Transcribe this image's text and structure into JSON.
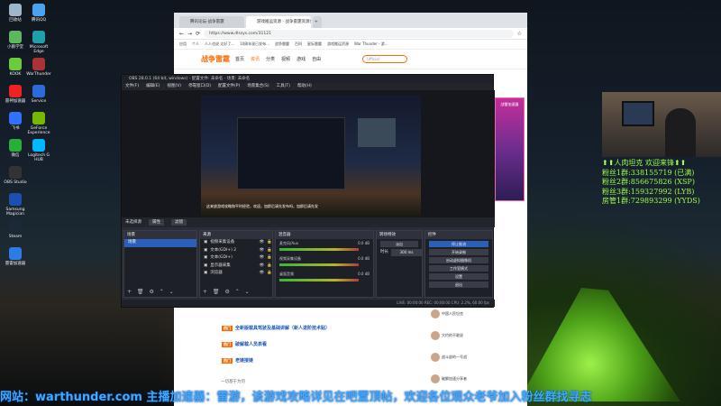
{
  "desktop": {
    "icons": [
      {
        "label": "回收站",
        "color": "#9fb5c9"
      },
      {
        "label": "腾讯QQ",
        "color": "#4aa3ef"
      },
      {
        "label": "小鹅学堂",
        "color": "#5cb85c"
      },
      {
        "label": "Microsoft Edge",
        "color": "#1fa0a8"
      },
      {
        "label": "KOOK",
        "color": "#6bcb3b"
      },
      {
        "label": "WarThunder",
        "color": "#a33"
      },
      {
        "label": "雷神加速器",
        "color": "#e22"
      },
      {
        "label": "Service",
        "color": "#2d6bd8"
      },
      {
        "label": "飞书",
        "color": "#3370ff"
      },
      {
        "label": "GeForce Experience",
        "color": "#76b900"
      },
      {
        "label": "微信",
        "color": "#2bad3b"
      },
      {
        "label": "Logitech G HUB",
        "color": "#00b8fc"
      },
      {
        "label": "OBS Studio",
        "color": "#333"
      },
      {
        "label": "Samsung Magician",
        "color": "#1d4fb1"
      },
      {
        "label": "Steam",
        "color": "#1b2838"
      },
      {
        "label": "雷雷加速器",
        "color": "#2d7be6"
      }
    ]
  },
  "browser": {
    "tabs": [
      "腾讯论坛-战争雷霆",
      "游戏搬运资源 - 战争雷霆资源分享",
      "+"
    ],
    "url": "https://www.dlssys.com/31121",
    "bookmarks": [
      "应用",
      "个人",
      "人人也说 太好了...",
      "10周年现已发布...",
      "战争雷霆",
      "百科",
      "星际雷霆",
      "游戏搬运资源",
      "War Thunder - 游..."
    ],
    "site": {
      "logo": "战争雷霆",
      "nav": [
        "首页",
        "资讯",
        "分类",
        "视频",
        "游戏",
        "自由"
      ],
      "active_nav": "资讯",
      "search_placeholder": "Ufficial"
    },
    "articles": [
      {
        "tag": "热门",
        "title": "全新版载具驾驶及基础讲解（新人进阶技术贴）"
      },
      {
        "tag": "热门",
        "title": "破解载人员表看"
      },
      {
        "tag": "热门",
        "title": "老链接链"
      }
    ],
    "comment_author": "一切基于为何",
    "comments": [
      "中国人民坦克",
      "大约的不敢说",
      "战斗部的一号战",
      "破解加速分享者"
    ]
  },
  "obs": {
    "title": "OBS 28.0.1 (64 bit, windows) - 配置文件: 未命名 - 场景: 未命名",
    "menu": [
      "文件(F)",
      "编辑(E)",
      "视图(V)",
      "停靠窗口(D)",
      "配置文件(P)",
      "场景集合(S)",
      "工具(T)",
      "帮助(H)"
    ],
    "preview_caption": "这来放游戏攻略和平时经验，欢迎，加群后请先发布吗，加群后请先发",
    "context_bar": {
      "label": "未选择源",
      "btn1": "属性",
      "btn2": "滤镜"
    },
    "scenes": {
      "title": "场景",
      "items": [
        "场景"
      ]
    },
    "sources": {
      "title": "来源",
      "items": [
        "视频采集设备",
        "文本(GDI+) 2",
        "文本(GDI+)",
        "显示器采集",
        "浏览器"
      ]
    },
    "mixer": {
      "title": "混音器",
      "channels": [
        {
          "name": "麦克风/Aux",
          "db": "0.0 dB"
        },
        {
          "name": "视频采集设备",
          "db": "0.0 dB"
        },
        {
          "name": "桌面音频",
          "db": "0.0 dB"
        }
      ]
    },
    "transitions": {
      "title": "转场特效",
      "mode": "淡出",
      "duration_label": "时长",
      "duration": "300 ms"
    },
    "controls": {
      "title": "控件",
      "buttons": [
        "停止推流",
        "开始录制",
        "启动虚拟摄像机",
        "工作室模式",
        "设置",
        "退出"
      ]
    },
    "status": "LIVE: 00:00:00   REC: 00:00:00   CPU: 2.2%, 60.00 fps"
  },
  "ad_text": "战雷加速器",
  "fans_overlay": [
    "⬆⬆人肉坦克 欢迎来锋⬆⬆",
    "粉丝1群:338155719 (已满)",
    "粉丝2群:856675826 (XSP)",
    "粉丝3群:159327992 (LYB)",
    "房管1群:729893299 (YYDS)"
  ],
  "ticker": "网站：warthunder.com   主播加速器：雷游，该游戏攻略详见在吧置顶帖，欢迎各位观众老爷加入粉丝群找寻志"
}
